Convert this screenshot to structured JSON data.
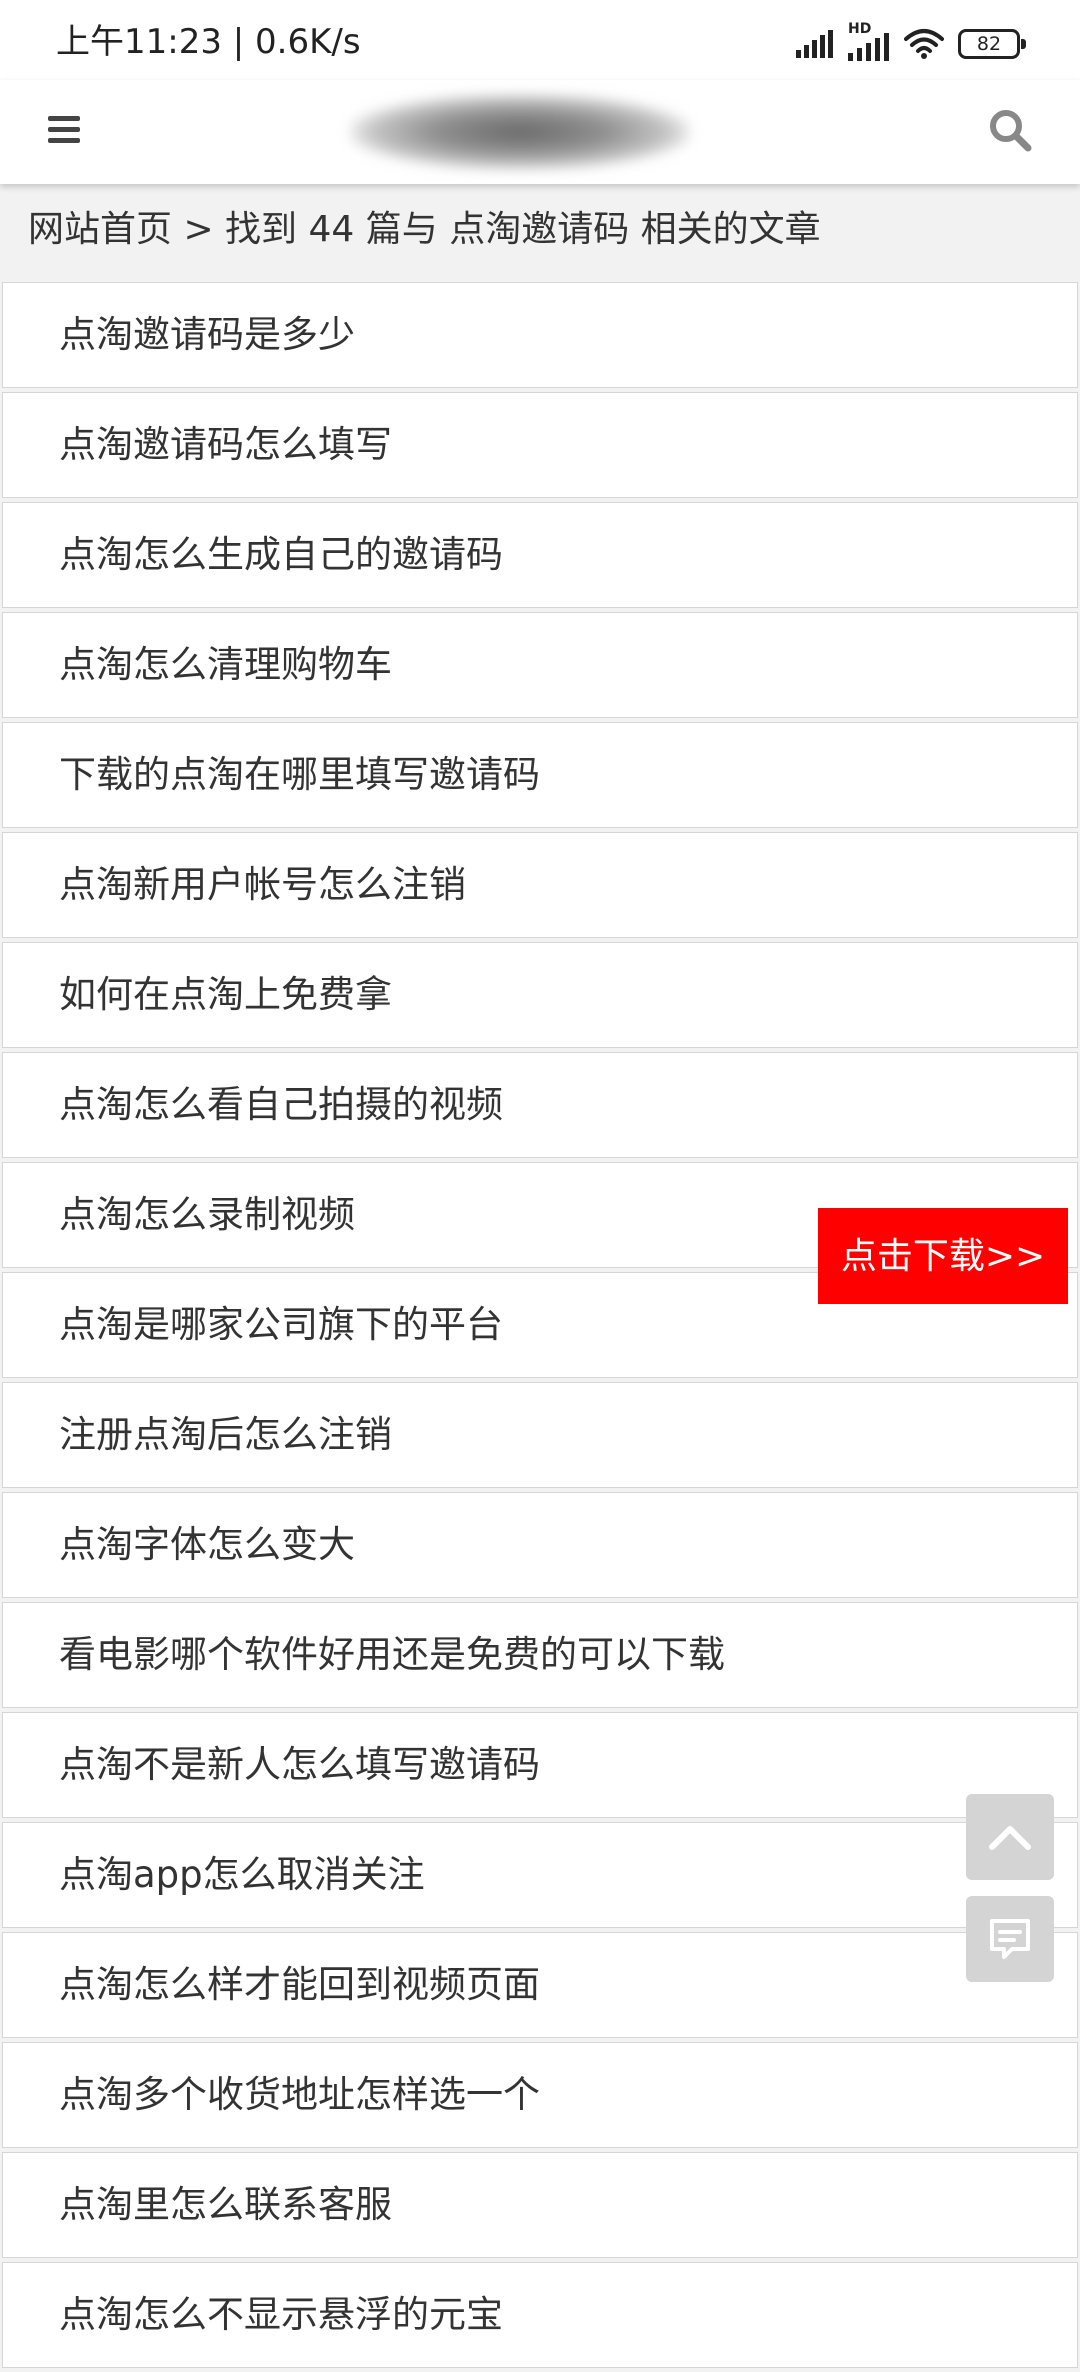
{
  "status_bar": {
    "time": "上午11:23 | 0.6K/s",
    "network_label": "HD",
    "battery": "82"
  },
  "header": {
    "menu_icon": "hamburger-menu-icon",
    "logo": "blurred-site-logo",
    "search_icon": "search-icon"
  },
  "breadcrumb": {
    "text": "网站首页 > 找到 44 篇与 点淘邀请码 相关的文章"
  },
  "articles": [
    "点淘邀请码是多少",
    "点淘邀请码怎么填写",
    "点淘怎么生成自己的邀请码",
    "点淘怎么清理购物车",
    "下载的点淘在哪里填写邀请码",
    "点淘新用户帐号怎么注销",
    "如何在点淘上免费拿",
    "点淘怎么看自己拍摄的视频",
    "点淘怎么录制视频",
    "点淘是哪家公司旗下的平台",
    "注册点淘后怎么注销",
    "点淘字体怎么变大",
    "看电影哪个软件好用还是免费的可以下载",
    "点淘不是新人怎么填写邀请码",
    "点淘app怎么取消关注",
    "点淘怎么样才能回到视频页面",
    "点淘多个收货地址怎样选一个",
    "点淘里怎么联系客服",
    "点淘怎么不显示悬浮的元宝"
  ],
  "floating": {
    "download_label": "点击下载>>",
    "download_color": "#ff0000",
    "back_to_top_icon": "chevron-up-icon",
    "feedback_icon": "comment-icon"
  }
}
